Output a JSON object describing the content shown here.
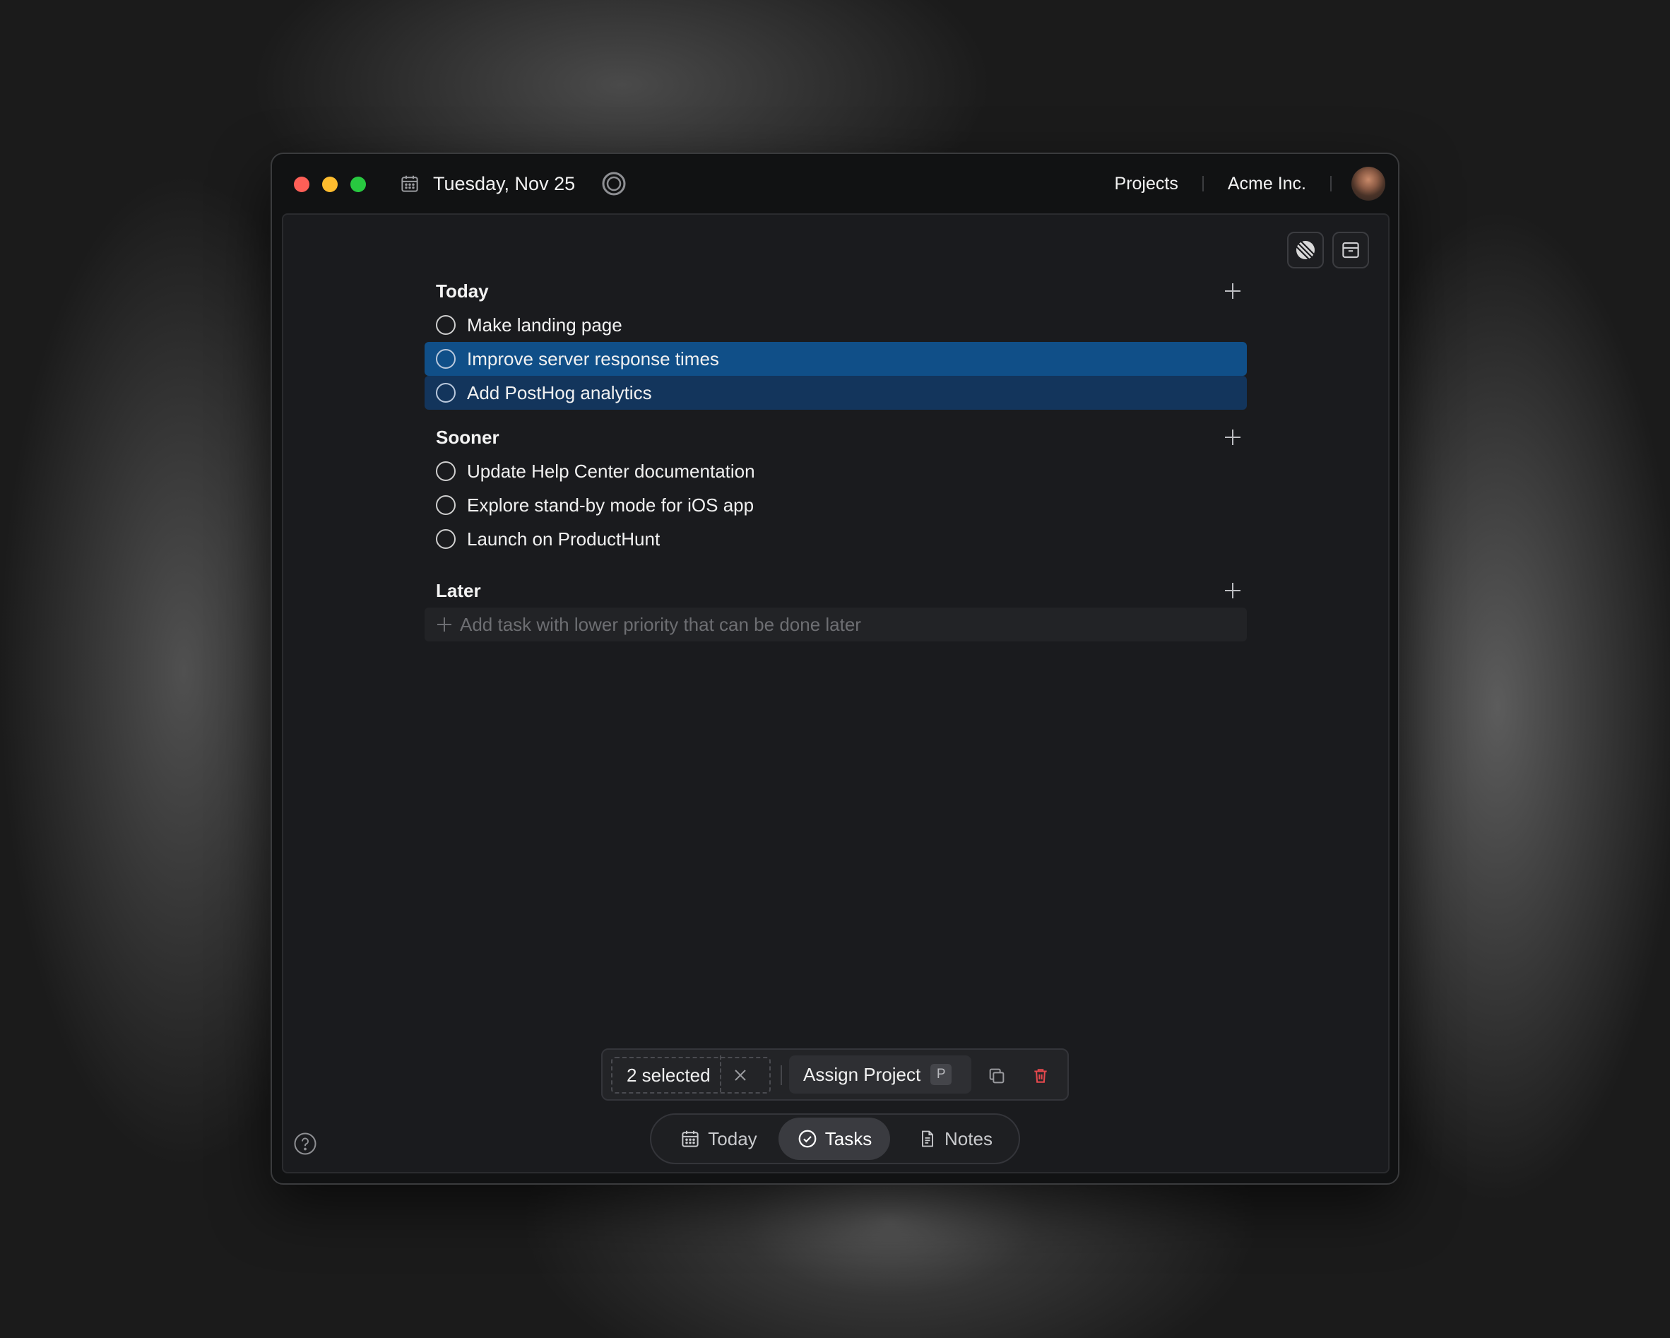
{
  "titlebar": {
    "date": "Tuesday, Nov 25",
    "links": {
      "projects": "Projects",
      "workspace": "Acme Inc."
    }
  },
  "toolbar": {
    "icons": [
      "linear-icon",
      "archive-icon"
    ]
  },
  "sections": {
    "today": {
      "title": "Today",
      "tasks": [
        {
          "label": "Make landing page",
          "selected": false
        },
        {
          "label": "Improve server response times",
          "selected": true
        },
        {
          "label": "Add PostHog analytics",
          "selected": true
        }
      ]
    },
    "sooner": {
      "title": "Sooner",
      "tasks": [
        {
          "label": "Update Help Center documentation",
          "selected": false
        },
        {
          "label": "Explore stand-by mode for iOS app",
          "selected": false
        },
        {
          "label": "Launch on ProductHunt",
          "selected": false
        }
      ]
    },
    "later": {
      "title": "Later",
      "placeholder": "Add task with lower priority that can be done later"
    }
  },
  "selection_bar": {
    "count_label": "2 selected",
    "assign_label": "Assign Project",
    "assign_shortcut": "P"
  },
  "bottom_nav": {
    "today": "Today",
    "tasks": "Tasks",
    "notes": "Notes",
    "active": "Tasks"
  },
  "colors": {
    "selected_primary": "#104f88",
    "selected_secondary": "#13355c",
    "danger": "#e5484d"
  }
}
